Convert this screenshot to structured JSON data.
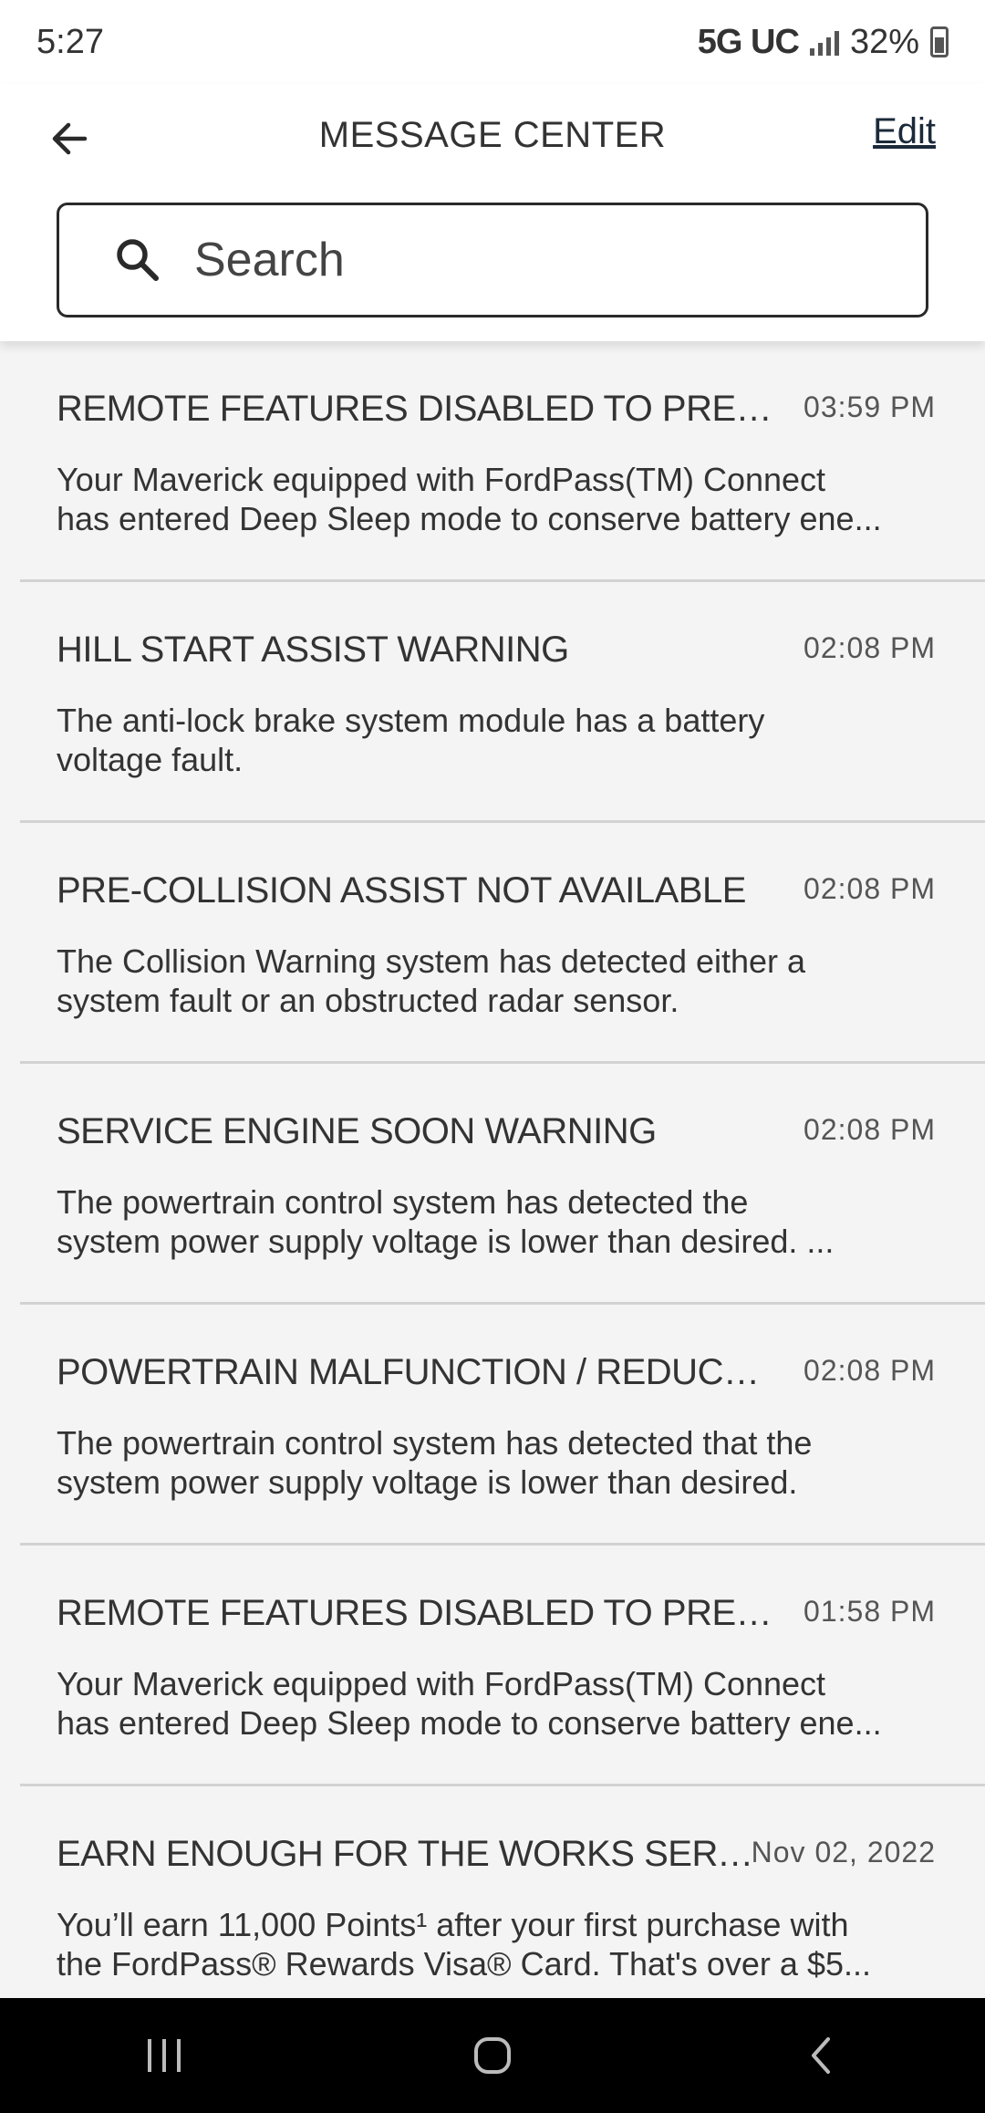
{
  "status_bar": {
    "time": "5:27",
    "network": "5G UC",
    "battery": "32%",
    "icons": [
      "signal-icon",
      "battery-icon"
    ]
  },
  "header": {
    "title": "MESSAGE CENTER",
    "edit_label": "Edit",
    "back_icon": "arrow-left-icon"
  },
  "search": {
    "placeholder": "Search",
    "icon": "search-icon"
  },
  "messages": [
    {
      "title": "REMOTE FEATURES DISABLED TO PRESERVE ...",
      "time": "03:59 PM",
      "body_line1": "Your Maverick equipped with FordPass(TM) Connect",
      "body_line2": "has entered Deep Sleep mode to conserve battery ene..."
    },
    {
      "title": "HILL START ASSIST WARNING",
      "time": "02:08 PM",
      "body_line1": "The anti-lock brake system module has a battery",
      "body_line2": "voltage fault."
    },
    {
      "title": "PRE-COLLISION ASSIST NOT AVAILABLE",
      "time": "02:08 PM",
      "body_line1": "The Collision Warning system has detected either a",
      "body_line2": "system fault or an obstructed radar sensor."
    },
    {
      "title": "SERVICE ENGINE SOON WARNING",
      "time": "02:08 PM",
      "body_line1": "The powertrain control system has detected the",
      "body_line2": "system power supply voltage is lower than desired. ..."
    },
    {
      "title": "POWERTRAIN MALFUNCTION / REDUCED PO...",
      "time": "02:08 PM",
      "body_line1": "The powertrain control system has detected that the",
      "body_line2": "system power supply voltage is lower than desired."
    },
    {
      "title": "REMOTE FEATURES DISABLED TO PRESERVE B...",
      "time": "01:58 PM",
      "body_line1": "Your Maverick equipped with FordPass(TM) Connect",
      "body_line2": "has entered Deep Sleep mode to conserve battery ene..."
    },
    {
      "title": "EARN ENOUGH FOR THE WORKS SERVICE ...",
      "time": "Nov 02, 2022",
      "body_line1": "You’ll earn 11,000 Points¹ after your first purchase with",
      "body_line2": "the FordPass® Rewards Visa® Card. That's over a $5..."
    }
  ],
  "nav_bar": {
    "icons": [
      "recent-apps-icon",
      "home-icon",
      "back-icon"
    ]
  }
}
